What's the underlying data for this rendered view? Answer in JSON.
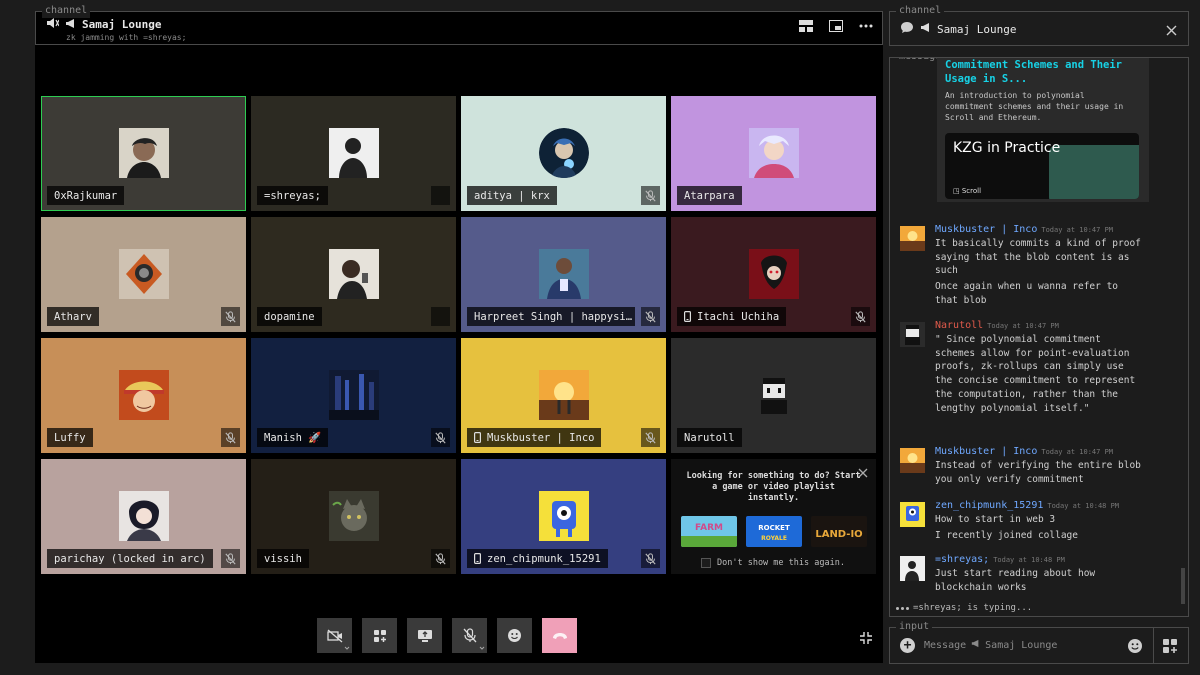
{
  "channel": {
    "legend": "channel",
    "title": "Samaj Lounge",
    "subtitle": "zk jamming with =shreyas;"
  },
  "participants": [
    {
      "name": "0xRajkumar",
      "bg": "#3d3b36",
      "active": true,
      "muted": false,
      "mobile": false
    },
    {
      "name": "=shreyas;",
      "bg": "#2c2a22",
      "active": false,
      "muted": false,
      "mobile": false,
      "placeholder": true
    },
    {
      "name": "aditya | krx",
      "bg": "#cfe3dc",
      "active": false,
      "muted": true,
      "mobile": false
    },
    {
      "name": "Atarpara",
      "bg": "#c194df",
      "active": false,
      "muted": false,
      "mobile": false
    },
    {
      "name": "Atharv",
      "bg": "#b4a18d",
      "active": false,
      "muted": true,
      "mobile": false
    },
    {
      "name": "dopamine",
      "bg": "#2e2a1f",
      "active": false,
      "muted": false,
      "mobile": false,
      "placeholder": true
    },
    {
      "name": "Harpreet Singh | happysi…",
      "bg": "#555b8b",
      "active": false,
      "muted": true,
      "mobile": false
    },
    {
      "name": "Itachi Uchiha",
      "bg": "#3a1a1f",
      "active": false,
      "muted": true,
      "mobile": true
    },
    {
      "name": "Luffy",
      "bg": "#c78f58",
      "active": false,
      "muted": true,
      "mobile": false
    },
    {
      "name": "Manish 🚀",
      "bg": "#122040",
      "active": false,
      "muted": true,
      "mobile": false
    },
    {
      "name": "Muskbuster | Inco",
      "bg": "#e6c13e",
      "active": false,
      "muted": true,
      "mobile": true
    },
    {
      "name": "Narutoll",
      "bg": "#2b2b2b",
      "active": false,
      "muted": false,
      "mobile": false
    },
    {
      "name": "parichay (locked in arc)",
      "bg": "#b8a29e",
      "active": false,
      "muted": true,
      "mobile": false
    },
    {
      "name": "vissih",
      "bg": "#241f17",
      "active": false,
      "muted": true,
      "mobile": false
    },
    {
      "name": "zen_chipmunk_15291",
      "bg": "#353f80",
      "active": false,
      "muted": true,
      "mobile": true
    }
  ],
  "activity_prompt": {
    "message": "Looking for something to do? Start a game or video playlist instantly.",
    "dont_show": "Don't show me this again.",
    "games": [
      "farm-game",
      "rocket-royale-game",
      "land-io-game"
    ]
  },
  "controls": [
    "camera-off",
    "activities",
    "screen-share",
    "mic-off",
    "emoji",
    "hang-up"
  ],
  "right_channel": {
    "legend": "channel",
    "title": "Samaj Lounge"
  },
  "messages": {
    "legend": "messages",
    "embed": {
      "title": "Commitment Schemes and Their Usage in S...",
      "description": "An introduction to polynomial commitment schemes and their usage in Scroll and Ethereum.",
      "image_title": "KZG in Practice",
      "image_brand": "Scroll"
    },
    "groups": [
      {
        "author": "Muskbuster | Inco",
        "color": "#6fa8ff",
        "time": "Today at 10:47 PM",
        "lines": [
          "It basically commits a kind of proof saying that the blob content is as such",
          "Once again when u wanna refer to that blob"
        ]
      },
      {
        "author": "Narutoll",
        "color": "#e05a4b",
        "time": "Today at 10:47 PM",
        "lines": [
          "\" Since polynomial commitment schemes allow for point-evaluation proofs, zk-rollups can simply use the concise commitment to represent the computation, rather than the lengthy polynomial itself.\""
        ]
      },
      {
        "author": "Muskbuster | Inco",
        "color": "#6fa8ff",
        "time": "Today at 10:47 PM",
        "lines": [
          "Instead of verifying the entire blob you only verify commitment"
        ]
      },
      {
        "author": "zen_chipmunk_15291",
        "color": "#6fa8ff",
        "time": "Today at 10:48 PM",
        "lines": [
          "How to start in web 3",
          " I recently joined collage"
        ]
      },
      {
        "author": "=shreyas;",
        "color": "#6fa8ff",
        "time": "Today at 10:48 PM",
        "lines": [
          "Just start reading about how blockchain works"
        ]
      }
    ],
    "typing": "=shreyas; is typing..."
  },
  "input": {
    "legend": "input",
    "placeholder": "Message",
    "channel": "Samaj Lounge"
  }
}
